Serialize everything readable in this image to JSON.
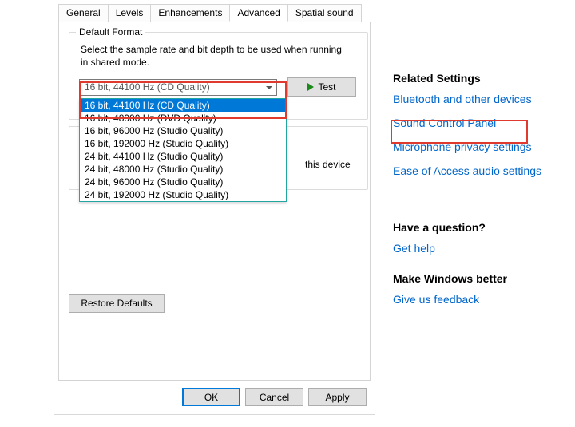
{
  "tabs": {
    "general": "General",
    "levels": "Levels",
    "enhancements": "Enhancements",
    "advanced": "Advanced",
    "spatial": "Spatial sound"
  },
  "defaultFormat": {
    "legend": "Default Format",
    "description": "Select the sample rate and bit depth to be used when running in shared mode.",
    "selected": "16 bit, 44100 Hz (CD Quality)",
    "testLabel": "Test"
  },
  "dropdown": {
    "items": [
      "16 bit, 44100 Hz (CD Quality)",
      "16 bit, 48000 Hz (DVD Quality)",
      "16 bit, 96000 Hz (Studio Quality)",
      "16 bit, 192000 Hz (Studio Quality)",
      "24 bit, 44100 Hz (Studio Quality)",
      "24 bit, 48000 Hz (Studio Quality)",
      "24 bit, 96000 Hz (Studio Quality)",
      "24 bit, 192000 Hz (Studio Quality)"
    ]
  },
  "exclusive": {
    "partialText": "this device"
  },
  "buttons": {
    "restore": "Restore Defaults",
    "ok": "OK",
    "cancel": "Cancel",
    "apply": "Apply"
  },
  "right": {
    "relatedHeading": "Related Settings",
    "bluetooth": "Bluetooth and other devices",
    "soundControl": "Sound Control Panel",
    "micPrivacy": "Microphone privacy settings",
    "easeAudio": "Ease of Access audio settings",
    "questionHeading": "Have a question?",
    "getHelp": "Get help",
    "feedbackHeading": "Make Windows better",
    "giveFeedback": "Give us feedback"
  }
}
